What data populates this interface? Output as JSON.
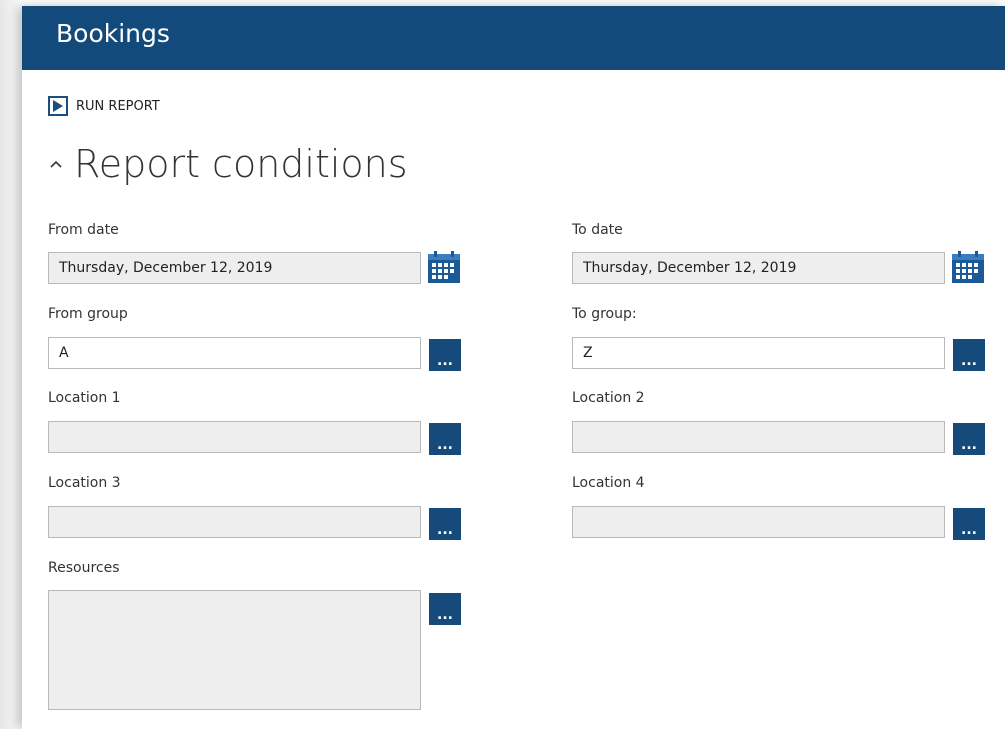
{
  "window": {
    "title": "Bookings"
  },
  "toolbar": {
    "run_report_label": "RUN REPORT"
  },
  "section": {
    "title": "Report conditions"
  },
  "fields": {
    "from_date": {
      "label": "From date",
      "value": "Thursday, December 12, 2019"
    },
    "to_date": {
      "label": "To date",
      "value": "Thursday, December 12, 2019"
    },
    "from_group": {
      "label": "From group",
      "value": "A"
    },
    "to_group": {
      "label": "To group:",
      "value": "Z"
    },
    "location1": {
      "label": "Location 1",
      "value": ""
    },
    "location2": {
      "label": "Location 2",
      "value": ""
    },
    "location3": {
      "label": "Location 3",
      "value": ""
    },
    "location4": {
      "label": "Location 4",
      "value": ""
    },
    "resources": {
      "label": "Resources",
      "value": ""
    }
  },
  "buttons": {
    "browse_label": "..."
  },
  "colors": {
    "header": "#134a7c",
    "button": "#154a7a",
    "input_bg": "#eeeeee"
  },
  "icons": {
    "run": "play-icon",
    "collapse": "chevron-up-icon",
    "date_picker": "calendar-icon",
    "browse": "ellipsis-icon"
  }
}
